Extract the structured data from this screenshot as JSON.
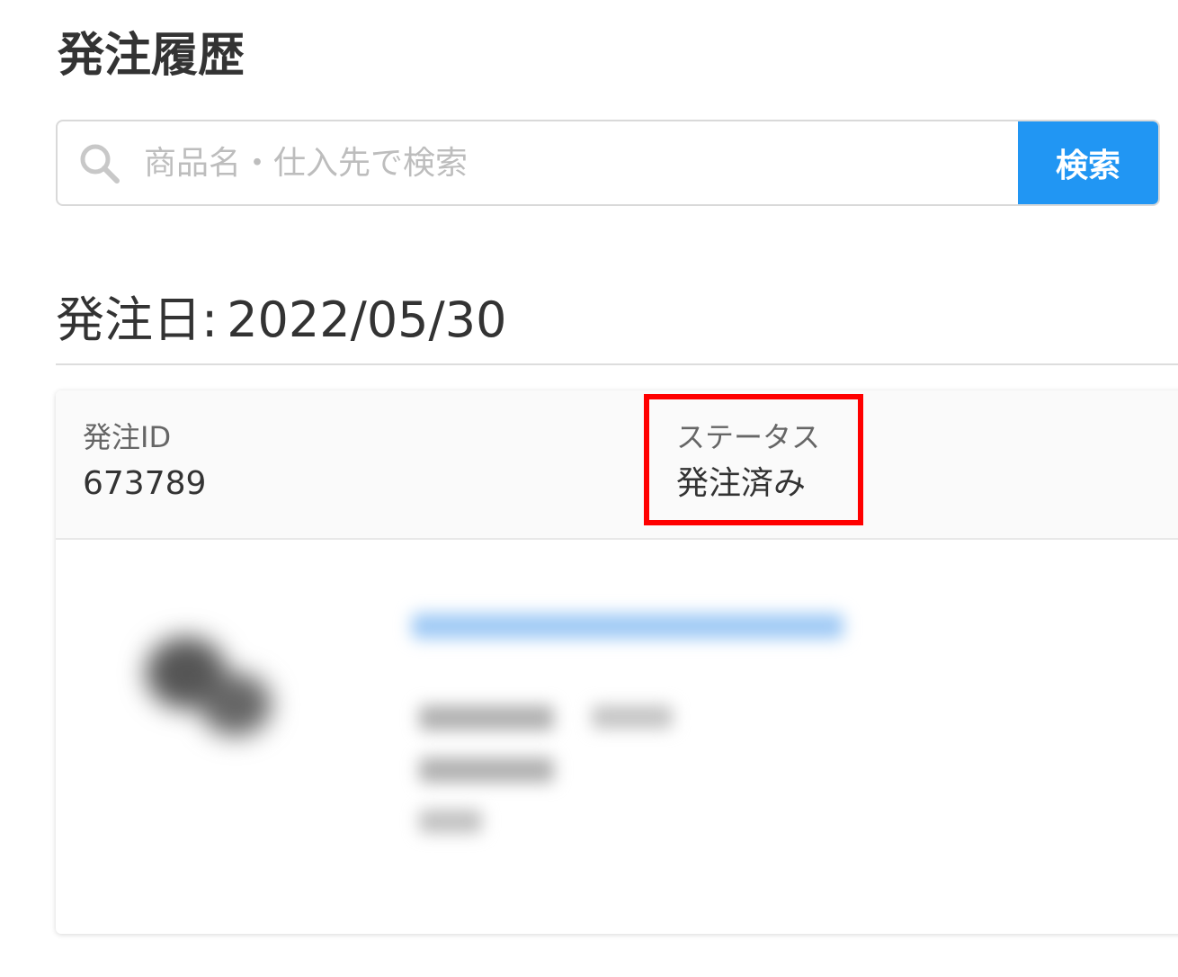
{
  "page": {
    "title": "発注履歴"
  },
  "search": {
    "placeholder": "商品名・仕入先で検索",
    "button_label": "検索"
  },
  "order_group": {
    "date_label": "発注日:",
    "date_value": "2022/05/30"
  },
  "order": {
    "id_label": "発注ID",
    "id_value": "673789",
    "status_label": "ステータス",
    "status_value": "発注済み"
  },
  "colors": {
    "accent": "#2196f3",
    "highlight": "#ff0000",
    "text": "#333333",
    "placeholder": "#bdbdbd"
  },
  "icons": {
    "search": "search-icon"
  }
}
